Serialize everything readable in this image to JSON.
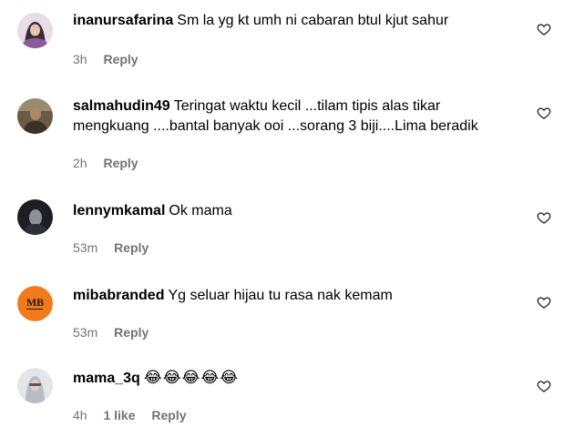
{
  "comments": [
    {
      "username": "inanursafarina",
      "text": "Sm la yg kt umh ni cabaran btul kjut sahur",
      "time": "3h",
      "likes": "",
      "reply_label": "Reply",
      "avatar_icon": "user-avatar-hijab-purple"
    },
    {
      "username": "salmahudin49",
      "text": "Teringat waktu kecil ...tilam tipis alas tikar mengkuang ....bantal banyak ooi ...sorang 3 biji....Lima beradik",
      "time": "2h",
      "likes": "",
      "reply_label": "Reply",
      "avatar_icon": "user-avatar-photo"
    },
    {
      "username": "lennymkamal",
      "text": "Ok mama",
      "time": "53m",
      "likes": "",
      "reply_label": "Reply",
      "avatar_icon": "user-avatar-dark"
    },
    {
      "username": "mibabranded",
      "text": "Yg seluar hijau tu rasa nak kemam",
      "time": "53m",
      "likes": "",
      "reply_label": "Reply",
      "avatar_icon": "mb-brand-logo",
      "avatar_text": "MB"
    },
    {
      "username": "mama_3q",
      "text": "😂😂😂😂😂",
      "time": "4h",
      "likes": "1 like",
      "reply_label": "Reply",
      "avatar_icon": "user-avatar-hijab-grey"
    }
  ],
  "colors": {
    "meta_text": "#737373",
    "mb_logo_bg": "#f07a1c"
  }
}
